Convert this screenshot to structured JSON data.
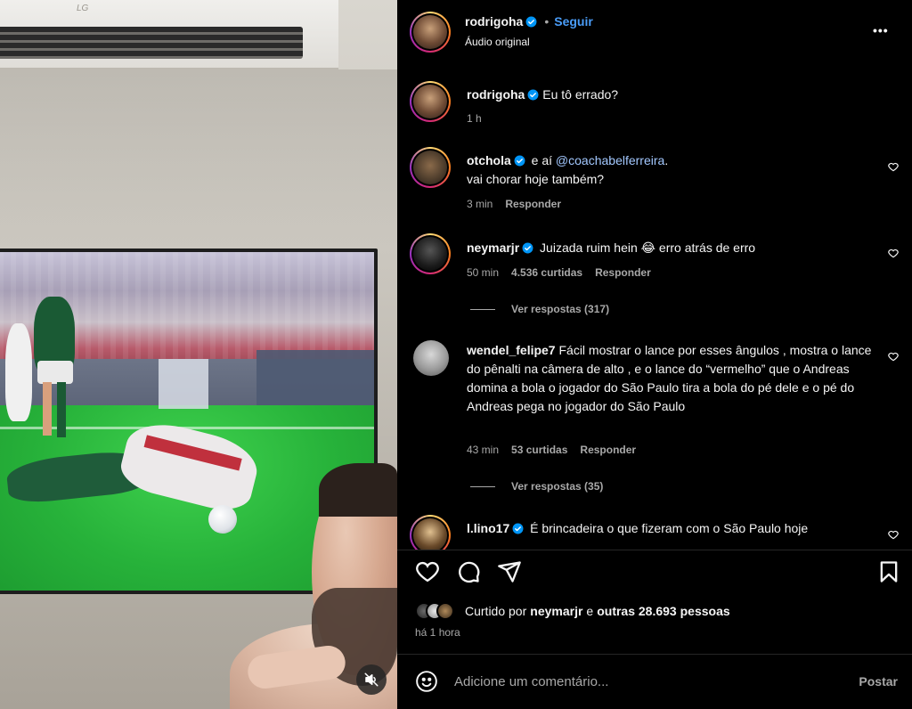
{
  "video": {
    "mute_icon": "speaker-muted-icon",
    "ac_logo": "LG"
  },
  "header": {
    "username": "rodrigoha",
    "dot": "•",
    "follow_label": "Seguir",
    "audio_label": "Áudio original",
    "more_icon": "more-options-icon",
    "more_label": "•••"
  },
  "caption": {
    "username": "rodrigoha",
    "text": "Eu tô errado?",
    "time": "1 h"
  },
  "comments": [
    {
      "username": "otchola",
      "verified": true,
      "text_before": "e aí",
      "mention": "@coachabelferreira",
      "text_after": ".",
      "line2": "vai chorar hoje também?",
      "time": "3 min",
      "likes": "",
      "reply_label": "Responder"
    },
    {
      "username": "neymarjr",
      "verified": true,
      "text": "Juizada ruim hein 😂 erro atrás de erro",
      "time": "50 min",
      "likes": "4.536 curtidas",
      "reply_label": "Responder",
      "view_replies": "Ver respostas (317)"
    },
    {
      "username": "wendel_felipe7",
      "verified": false,
      "text": "Fácil mostrar o lance por esses ângulos , mostra o lance do pênalti na câmera de alto , e o lance do “vermelho” que o Andreas domina a bola o jogador do São Paulo tira a bola do pé dele e o pé do Andreas pega no jogador do São Paulo",
      "time": "43 min",
      "likes": "53 curtidas",
      "reply_label": "Responder",
      "view_replies": "Ver respostas (35)"
    },
    {
      "username": "l.lino17",
      "verified": true,
      "text": "É brincadeira o que fizeram com o São Paulo hoje"
    }
  ],
  "actions": {
    "like_icon": "heart-icon",
    "comment_icon": "comment-icon",
    "share_icon": "share-icon",
    "save_icon": "bookmark-icon"
  },
  "likes_line": {
    "prefix": "Curtido por",
    "user": "neymarjr",
    "mid": "e",
    "others": "outras 28.693 pessoas"
  },
  "post_time": "há 1 hora",
  "add_comment": {
    "placeholder": "Adicione um comentário...",
    "post_label": "Postar",
    "emoji_icon": "emoji-icon"
  },
  "colors": {
    "background": "#000000",
    "text": "#f5f5f5",
    "muted": "#a8a8a8",
    "follow": "#0095f6",
    "mention": "#e0f1ff"
  }
}
